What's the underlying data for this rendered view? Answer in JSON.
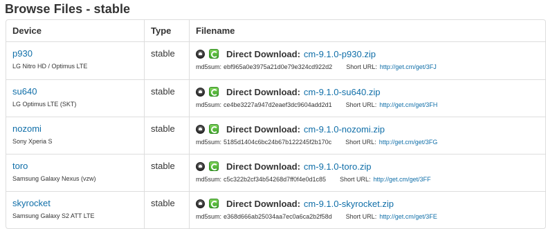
{
  "page": {
    "title": "Browse Files - stable"
  },
  "table": {
    "headers": {
      "device": "Device",
      "type": "Type",
      "filename": "Filename"
    },
    "direct_download_label": "Direct Download:",
    "md5_label": "md5sum:",
    "short_url_label": "Short URL:",
    "rows": [
      {
        "device": "p930",
        "description": "LG Nitro HD / Optimus LTE",
        "type": "stable",
        "file": "cm-9.1.0-p930.zip",
        "md5": "ebf965a0e3975a21d0e79e324cd922d2",
        "short_url": "http://get.cm/get/3FJ"
      },
      {
        "device": "su640",
        "description": "LG Optimus LTE (SKT)",
        "type": "stable",
        "file": "cm-9.1.0-su640.zip",
        "md5": "ce4be3227a947d2eaef3dc9604add2d1",
        "short_url": "http://get.cm/get/3FH"
      },
      {
        "device": "nozomi",
        "description": "Sony Xperia S",
        "type": "stable",
        "file": "cm-9.1.0-nozomi.zip",
        "md5": "5185d1404c6bc24b67b122245f2b170c",
        "short_url": "http://get.cm/get/3FG"
      },
      {
        "device": "toro",
        "description": "Samsung Galaxy Nexus (vzw)",
        "type": "stable",
        "file": "cm-9.1.0-toro.zip",
        "md5": "c5c322b2cf34b54268d7ff0f4e0d1c85",
        "short_url": "http://get.cm/get/3FF"
      },
      {
        "device": "skyrocket",
        "description": "Samsung Galaxy S2 ATT LTE",
        "type": "stable",
        "file": "cm-9.1.0-skyrocket.zip",
        "md5": "e368d666ab25034aa7ec0a6ca2b2f58d",
        "short_url": "http://get.cm/get/3FE"
      }
    ]
  },
  "icons": {
    "android": "android-icon",
    "download": "download-icon"
  },
  "colors": {
    "link": "#0f6ea8",
    "border": "#dddddd",
    "text": "#333333"
  }
}
